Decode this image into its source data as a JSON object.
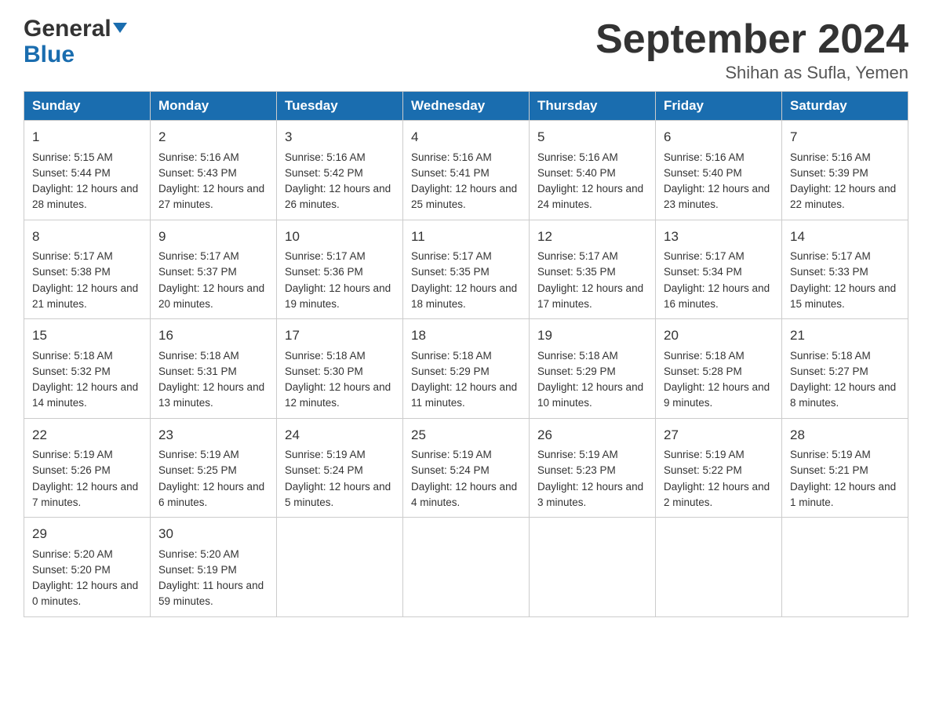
{
  "header": {
    "logo_general": "General",
    "logo_blue": "Blue",
    "month_title": "September 2024",
    "location": "Shihan as Sufla, Yemen"
  },
  "days_of_week": [
    "Sunday",
    "Monday",
    "Tuesday",
    "Wednesday",
    "Thursday",
    "Friday",
    "Saturday"
  ],
  "weeks": [
    [
      {
        "day": "1",
        "sunrise": "5:15 AM",
        "sunset": "5:44 PM",
        "daylight": "12 hours and 28 minutes."
      },
      {
        "day": "2",
        "sunrise": "5:16 AM",
        "sunset": "5:43 PM",
        "daylight": "12 hours and 27 minutes."
      },
      {
        "day": "3",
        "sunrise": "5:16 AM",
        "sunset": "5:42 PM",
        "daylight": "12 hours and 26 minutes."
      },
      {
        "day": "4",
        "sunrise": "5:16 AM",
        "sunset": "5:41 PM",
        "daylight": "12 hours and 25 minutes."
      },
      {
        "day": "5",
        "sunrise": "5:16 AM",
        "sunset": "5:40 PM",
        "daylight": "12 hours and 24 minutes."
      },
      {
        "day": "6",
        "sunrise": "5:16 AM",
        "sunset": "5:40 PM",
        "daylight": "12 hours and 23 minutes."
      },
      {
        "day": "7",
        "sunrise": "5:16 AM",
        "sunset": "5:39 PM",
        "daylight": "12 hours and 22 minutes."
      }
    ],
    [
      {
        "day": "8",
        "sunrise": "5:17 AM",
        "sunset": "5:38 PM",
        "daylight": "12 hours and 21 minutes."
      },
      {
        "day": "9",
        "sunrise": "5:17 AM",
        "sunset": "5:37 PM",
        "daylight": "12 hours and 20 minutes."
      },
      {
        "day": "10",
        "sunrise": "5:17 AM",
        "sunset": "5:36 PM",
        "daylight": "12 hours and 19 minutes."
      },
      {
        "day": "11",
        "sunrise": "5:17 AM",
        "sunset": "5:35 PM",
        "daylight": "12 hours and 18 minutes."
      },
      {
        "day": "12",
        "sunrise": "5:17 AM",
        "sunset": "5:35 PM",
        "daylight": "12 hours and 17 minutes."
      },
      {
        "day": "13",
        "sunrise": "5:17 AM",
        "sunset": "5:34 PM",
        "daylight": "12 hours and 16 minutes."
      },
      {
        "day": "14",
        "sunrise": "5:17 AM",
        "sunset": "5:33 PM",
        "daylight": "12 hours and 15 minutes."
      }
    ],
    [
      {
        "day": "15",
        "sunrise": "5:18 AM",
        "sunset": "5:32 PM",
        "daylight": "12 hours and 14 minutes."
      },
      {
        "day": "16",
        "sunrise": "5:18 AM",
        "sunset": "5:31 PM",
        "daylight": "12 hours and 13 minutes."
      },
      {
        "day": "17",
        "sunrise": "5:18 AM",
        "sunset": "5:30 PM",
        "daylight": "12 hours and 12 minutes."
      },
      {
        "day": "18",
        "sunrise": "5:18 AM",
        "sunset": "5:29 PM",
        "daylight": "12 hours and 11 minutes."
      },
      {
        "day": "19",
        "sunrise": "5:18 AM",
        "sunset": "5:29 PM",
        "daylight": "12 hours and 10 minutes."
      },
      {
        "day": "20",
        "sunrise": "5:18 AM",
        "sunset": "5:28 PM",
        "daylight": "12 hours and 9 minutes."
      },
      {
        "day": "21",
        "sunrise": "5:18 AM",
        "sunset": "5:27 PM",
        "daylight": "12 hours and 8 minutes."
      }
    ],
    [
      {
        "day": "22",
        "sunrise": "5:19 AM",
        "sunset": "5:26 PM",
        "daylight": "12 hours and 7 minutes."
      },
      {
        "day": "23",
        "sunrise": "5:19 AM",
        "sunset": "5:25 PM",
        "daylight": "12 hours and 6 minutes."
      },
      {
        "day": "24",
        "sunrise": "5:19 AM",
        "sunset": "5:24 PM",
        "daylight": "12 hours and 5 minutes."
      },
      {
        "day": "25",
        "sunrise": "5:19 AM",
        "sunset": "5:24 PM",
        "daylight": "12 hours and 4 minutes."
      },
      {
        "day": "26",
        "sunrise": "5:19 AM",
        "sunset": "5:23 PM",
        "daylight": "12 hours and 3 minutes."
      },
      {
        "day": "27",
        "sunrise": "5:19 AM",
        "sunset": "5:22 PM",
        "daylight": "12 hours and 2 minutes."
      },
      {
        "day": "28",
        "sunrise": "5:19 AM",
        "sunset": "5:21 PM",
        "daylight": "12 hours and 1 minute."
      }
    ],
    [
      {
        "day": "29",
        "sunrise": "5:20 AM",
        "sunset": "5:20 PM",
        "daylight": "12 hours and 0 minutes."
      },
      {
        "day": "30",
        "sunrise": "5:20 AM",
        "sunset": "5:19 PM",
        "daylight": "11 hours and 59 minutes."
      },
      null,
      null,
      null,
      null,
      null
    ]
  ]
}
